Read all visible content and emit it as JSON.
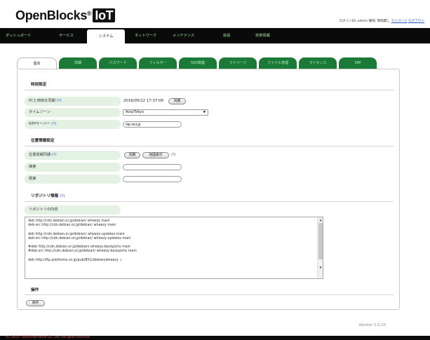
{
  "header": {
    "logo_text": "OpenBlocks",
    "logo_reg": "®",
    "logo_badge": "IoT",
    "login_label": "ログインID: admin 権限: 制限無し",
    "mypage_link": "マイページ",
    "logout_link": "ログアウト"
  },
  "nav": {
    "items": [
      "ダッシュボード",
      "サービス",
      "システム",
      "ネットワーク",
      "メンテナンス",
      "拡張",
      "技術情報"
    ],
    "active": "システム"
  },
  "tabs": {
    "items": [
      "基本",
      "詳細",
      "パスワード",
      "フィルター",
      "SSH関連",
      "マイページ",
      "ファイル管理",
      "ライセンス",
      "SIM"
    ],
    "active": "基本"
  },
  "time_section": {
    "title": "時刻設定",
    "sync_label": "PCと時刻を同期",
    "sync_help": "(?)",
    "datetime_value": "2016/05/12 17:37:06",
    "sync_button": "同期",
    "timezone_label": "タイムゾーン",
    "timezone_value": "Asia/Tokyo",
    "ntp_label": "NTPサーバー",
    "ntp_help": "(?)",
    "ntp_value": "ntp.nict.jp"
  },
  "location_section": {
    "title": "位置情報設定",
    "sync_label": "位置情報同期",
    "sync_help": "(?)",
    "sync_button": "同期",
    "map_button": "地図表示",
    "map_help": "(?)",
    "lat_label": "緯度",
    "lat_value": "",
    "lng_label": "経度",
    "lng_value": ""
  },
  "repo_section": {
    "title": "リポジトリ情報",
    "title_help": "(?)",
    "content_label": "リポジトリの内容",
    "content": "deb http://cdn.debian.or.jp/debian/ wheezy main\ndeb-src http://cdn.debian.or.jp/debian/ wheezy main\n\ndeb http://cdn.debian.or.jp/debian/ wheezy-updates main\ndeb-src http://cdn.debian.or.jp/debian/ wheezy-updates main\n\n#deb http://cdn.debian.or.jp/debian/ wheezy-backports main\n#deb-src http://cdn.debian.or.jp/debian/ wheezy-backports main\n\ndeb http://ftp.plathome.co.jp/pub/BX1/debian/wheezy ./"
  },
  "operation_section": {
    "title": "操作",
    "save_button": "保存"
  },
  "version": "Version 1.0.10",
  "footer": "(C) 2015 - 2016 Plat'Home Co., Ltd. All rights reserved."
}
